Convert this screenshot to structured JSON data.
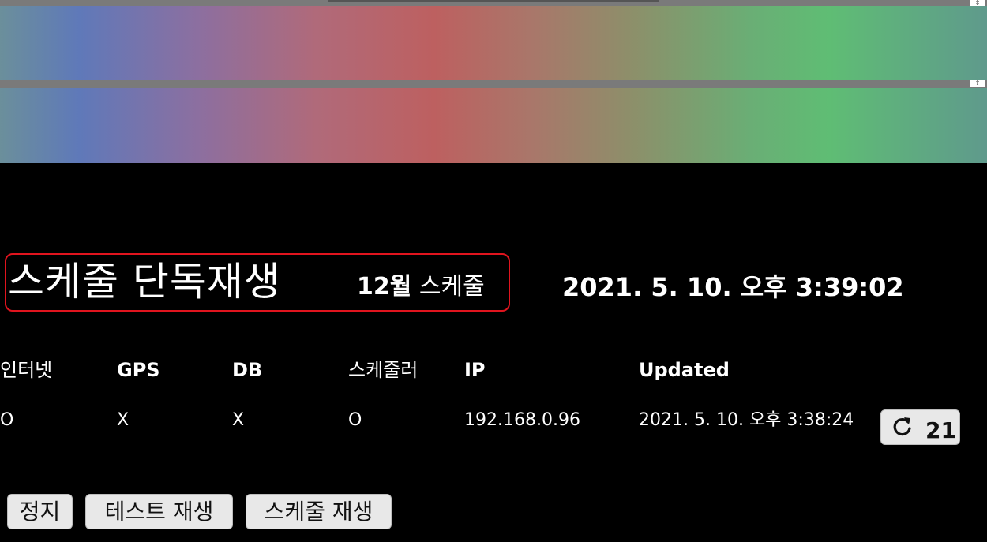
{
  "title": {
    "main": "스케줄 단독재생",
    "sub_number": "12월",
    "sub_text": "스케줄"
  },
  "clock": "2021. 5. 10. 오후 3:39:02",
  "status_table": {
    "headers": [
      "인터넷",
      "GPS",
      "DB",
      "스케줄러",
      "IP",
      "Updated"
    ],
    "values": [
      "O",
      "X",
      "X",
      "O",
      "192.168.0.96",
      "2021. 5. 10. 오후 3:38:24"
    ]
  },
  "refresh": {
    "icon": "refresh-icon",
    "count": "21"
  },
  "buttons": {
    "stop": "정지",
    "test_play": "테스트 재생",
    "schedule_play": "스케줄 재생"
  },
  "colors": {
    "background": "#000000",
    "title_border": "#e0141e",
    "button_bg": "#e8e8e8",
    "gradient": [
      "#5f79b9",
      "#bd6060",
      "#5fbd74"
    ]
  }
}
